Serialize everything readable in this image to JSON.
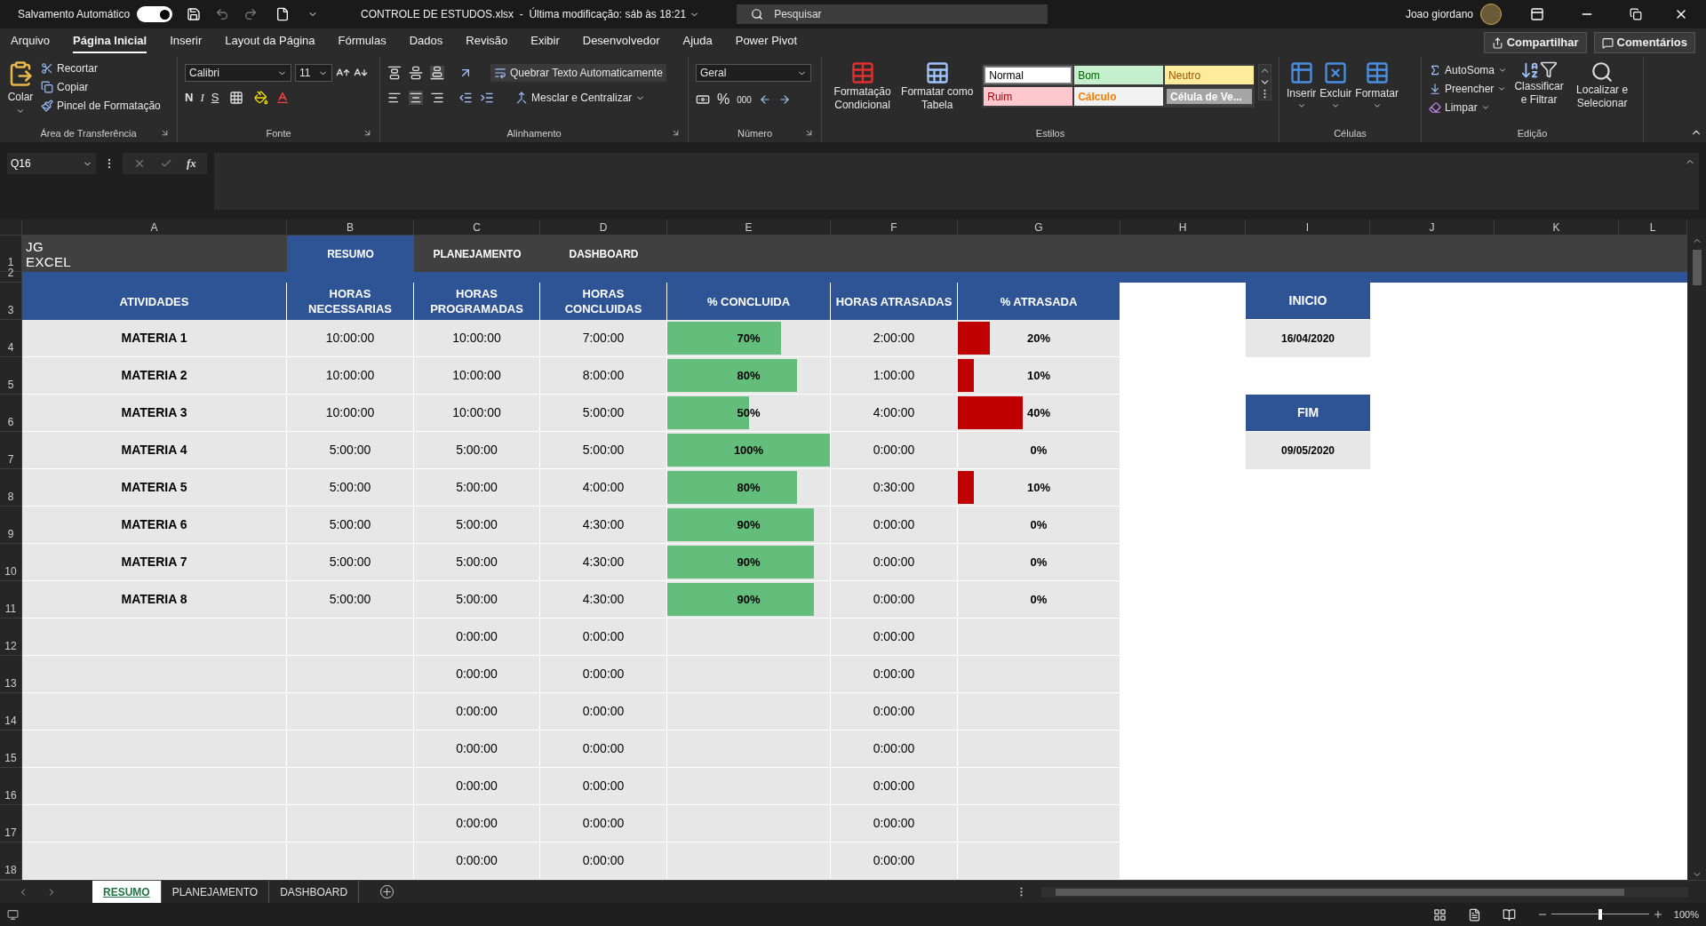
{
  "title_bar": {
    "autosave_label": "Salvamento Automático",
    "autosave_on": true,
    "file_title": "CONTROLE DE ESTUDOS.xlsx  -  Última modificação: sáb às 18:21",
    "search_placeholder": "Pesquisar",
    "user_name": "Joao giordano"
  },
  "menu_tabs": [
    {
      "label": "Arquivo",
      "selected": false
    },
    {
      "label": "Página Inicial",
      "selected": true
    },
    {
      "label": "Inserir",
      "selected": false
    },
    {
      "label": "Layout da Página",
      "selected": false
    },
    {
      "label": "Fórmulas",
      "selected": false
    },
    {
      "label": "Dados",
      "selected": false
    },
    {
      "label": "Revisão",
      "selected": false
    },
    {
      "label": "Exibir",
      "selected": false
    },
    {
      "label": "Desenvolvedor",
      "selected": false
    },
    {
      "label": "Ajuda",
      "selected": false
    },
    {
      "label": "Power Pivot",
      "selected": false
    }
  ],
  "share_buttons": [
    "Compartilhar",
    "Comentários"
  ],
  "ribbon": {
    "clipboard": {
      "paste": "Colar",
      "items": [
        "Recortar",
        "Copiar",
        "Pincel de Formatação"
      ],
      "label": "Área de Transferência"
    },
    "font": {
      "font_name": "Calibri",
      "font_size": "11",
      "bold": "N",
      "italic": "I",
      "underline": "S",
      "label": "Fonte"
    },
    "alignment": {
      "wrap": "Quebrar Texto Automaticamente",
      "merge": "Mesclar e Centralizar",
      "label": "Alinhamento"
    },
    "number": {
      "format": "Geral",
      "percent": "%",
      "thousands": "000",
      "label": "Número"
    },
    "styles": {
      "conditional": "Formatação Condicional",
      "as_table": "Formatar como Tabela",
      "label": "Estilos",
      "gallery": [
        {
          "label": "Normal",
          "kind": "normal"
        },
        {
          "label": "Bom",
          "kind": "good"
        },
        {
          "label": "Neutro",
          "kind": "neutral"
        },
        {
          "label": "Ruim",
          "kind": "bad"
        },
        {
          "label": "Cálculo",
          "kind": "calculation"
        },
        {
          "label": "Célula de Ve...",
          "kind": "check"
        }
      ]
    },
    "cells": {
      "buttons": [
        "Inserir",
        "Excluir",
        "Formatar"
      ],
      "label": "Células"
    },
    "editing": {
      "items": [
        "AutoSoma",
        "Preencher",
        "Limpar"
      ],
      "sort": "Classificar e Filtrar",
      "find": "Localizar e Selecionar",
      "label": "Edição"
    }
  },
  "formula_bar": {
    "name_box": "Q16",
    "fx": "fx"
  },
  "columns": [
    "A",
    "B",
    "C",
    "D",
    "E",
    "F",
    "G",
    "H",
    "I",
    "J",
    "K",
    "L"
  ],
  "row_numbers": [
    "1",
    "2",
    "3",
    "4",
    "5",
    "6",
    "7",
    "8",
    "9",
    "10",
    "11",
    "12",
    "13",
    "14",
    "15",
    "16",
    "17",
    "18"
  ],
  "logo": "JG EXCEL",
  "nav_tabs": [
    {
      "label": "RESUMO",
      "selected": true
    },
    {
      "label": "PLANEJAMENTO",
      "selected": false
    },
    {
      "label": "DASHBOARD",
      "selected": false
    }
  ],
  "table": {
    "columns": [
      "ATIVIDADES",
      "HORAS NECESSARIAS",
      "HORAS PROGRAMADAS",
      "HORAS CONCLUIDAS",
      "% CONCLUIDA",
      "HORAS ATRASADAS",
      "% ATRASADA"
    ],
    "rows": [
      {
        "atividade": "MATERIA 1",
        "horas_necessarias": "10:00:00",
        "horas_programadas": "10:00:00",
        "horas_concluidas": "7:00:00",
        "concluida": {
          "text": "70%",
          "level": 0.7
        },
        "horas_atrasadas": "2:00:00",
        "atrasada": {
          "text": "20%",
          "level": 0.2
        }
      },
      {
        "atividade": "MATERIA 2",
        "horas_necessarias": "10:00:00",
        "horas_programadas": "10:00:00",
        "horas_concluidas": "8:00:00",
        "concluida": {
          "text": "80%",
          "level": 0.8
        },
        "horas_atrasadas": "1:00:00",
        "atrasada": {
          "text": "10%",
          "level": 0.1
        }
      },
      {
        "atividade": "MATERIA 3",
        "horas_necessarias": "10:00:00",
        "horas_programadas": "10:00:00",
        "horas_concluidas": "5:00:00",
        "concluida": {
          "text": "50%",
          "level": 0.5
        },
        "horas_atrasadas": "4:00:00",
        "atrasada": {
          "text": "40%",
          "level": 0.4
        }
      },
      {
        "atividade": "MATERIA 4",
        "horas_necessarias": "5:00:00",
        "horas_programadas": "5:00:00",
        "horas_concluidas": "5:00:00",
        "concluida": {
          "text": "100%",
          "level": 1
        },
        "horas_atrasadas": "0:00:00",
        "atrasada": {
          "text": "0%"
        }
      },
      {
        "atividade": "MATERIA 5",
        "horas_necessarias": "5:00:00",
        "horas_programadas": "5:00:00",
        "horas_concluidas": "4:00:00",
        "concluida": {
          "text": "80%",
          "level": 0.8
        },
        "horas_atrasadas": "0:30:00",
        "atrasada": {
          "text": "10%",
          "level": 0.1
        }
      },
      {
        "atividade": "MATERIA 6",
        "horas_necessarias": "5:00:00",
        "horas_programadas": "5:00:00",
        "horas_concluidas": "4:30:00",
        "concluida": {
          "text": "90%",
          "level": 0.9
        },
        "horas_atrasadas": "0:00:00",
        "atrasada": {
          "text": "0%"
        }
      },
      {
        "atividade": "MATERIA 7",
        "horas_necessarias": "5:00:00",
        "horas_programadas": "5:00:00",
        "horas_concluidas": "4:30:00",
        "concluida": {
          "text": "90%",
          "level": 0.9
        },
        "horas_atrasadas": "0:00:00",
        "atrasada": {
          "text": "0%"
        }
      },
      {
        "atividade": "MATERIA 8",
        "horas_necessarias": "5:00:00",
        "horas_programadas": "5:00:00",
        "horas_concluidas": "4:30:00",
        "concluida": {
          "text": "90%",
          "level": 0.9
        },
        "horas_atrasadas": "0:00:00",
        "atrasada": {
          "text": "0%"
        }
      },
      {
        "horas_programadas": "0:00:00",
        "horas_concluidas": "0:00:00",
        "horas_atrasadas": "0:00:00"
      },
      {
        "horas_programadas": "0:00:00",
        "horas_concluidas": "0:00:00",
        "horas_atrasadas": "0:00:00"
      },
      {
        "horas_programadas": "0:00:00",
        "horas_concluidas": "0:00:00",
        "horas_atrasadas": "0:00:00"
      },
      {
        "horas_programadas": "0:00:00",
        "horas_concluidas": "0:00:00",
        "horas_atrasadas": "0:00:00"
      },
      {
        "horas_programadas": "0:00:00",
        "horas_concluidas": "0:00:00",
        "horas_atrasadas": "0:00:00"
      },
      {
        "horas_programadas": "0:00:00",
        "horas_concluidas": "0:00:00",
        "horas_atrasadas": "0:00:00"
      },
      {
        "horas_programadas": "0:00:00",
        "horas_concluidas": "0:00:00",
        "horas_atrasadas": "0:00:00"
      }
    ]
  },
  "dates": [
    {
      "label": "INICIO",
      "value": "16/04/2020"
    },
    {
      "label": "FIM",
      "value": "09/05/2020"
    }
  ],
  "sheet_tabs": [
    {
      "label": "RESUMO",
      "selected": true
    },
    {
      "label": "PLANEJAMENTO",
      "selected": false
    },
    {
      "label": "DASHBOARD",
      "selected": false
    }
  ],
  "status_bar": {
    "zoom": {
      "level": 0.5,
      "reading": "100%"
    }
  }
}
